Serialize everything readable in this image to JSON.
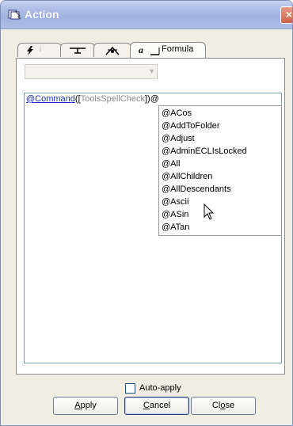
{
  "window": {
    "title": "Action",
    "close_glyph": "×",
    "icon": "action-icon"
  },
  "tabs": [
    {
      "icon": "lightning-icon",
      "label": "",
      "active": false
    },
    {
      "icon": "pin-icon",
      "label": "",
      "active": false
    },
    {
      "icon": "settings-icon",
      "label": "",
      "active": false
    },
    {
      "icon": "formula-a-icon",
      "label": "Formula",
      "active": true
    }
  ],
  "combo": {
    "value": "",
    "disabled": true
  },
  "editor": {
    "formula_cmd": "@Command",
    "formula_open": "([",
    "formula_arg": "ToolsSpellCheck",
    "formula_close": "])@"
  },
  "autocomplete": {
    "items": [
      "@ACos",
      "@AddToFolder",
      "@Adjust",
      "@AdminECLIsLocked",
      "@All",
      "@AllChildren",
      "@AllDescendants",
      "@Ascii",
      "@ASin",
      "@ATan"
    ]
  },
  "footer": {
    "auto_apply_label": "Auto-apply",
    "auto_apply_checked": false,
    "apply_first": "A",
    "apply_rest": "pply",
    "cancel_first": "C",
    "cancel_rest": "ancel",
    "close_pre": "Cl",
    "close_ul": "o",
    "close_post": "se"
  }
}
